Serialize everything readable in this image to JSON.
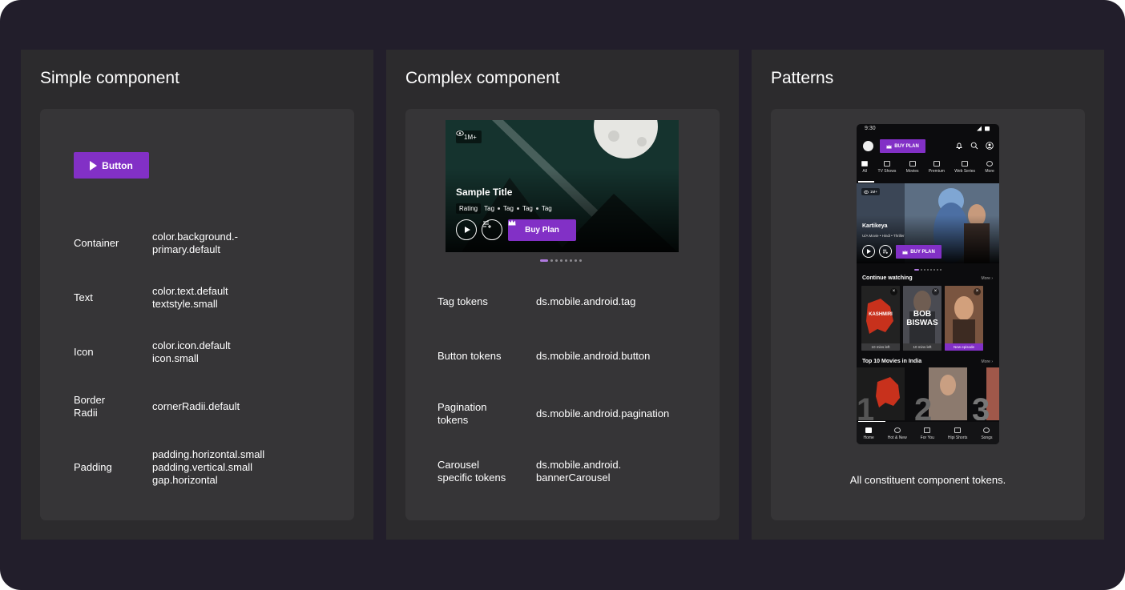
{
  "panels": {
    "simple": {
      "title": "Simple component",
      "button_label": "Button",
      "rows": [
        {
          "label": "Container",
          "value": "color.background.-\nprimary.default"
        },
        {
          "label": "Text",
          "value": "color.text.default\ntextstyle.small"
        },
        {
          "label": "Icon",
          "value": "color.icon.default\nicon.small"
        },
        {
          "label": "Border\nRadii",
          "value": "cornerRadii.default"
        },
        {
          "label": "Padding",
          "value": "padding.horizontal.small\npadding.vertical.small\ngap.horizontal"
        }
      ]
    },
    "complex": {
      "title": "Complex component",
      "banner": {
        "views": "1M+",
        "title": "Sample Title",
        "rating": "Rating",
        "tags": [
          "Tag",
          "Tag",
          "Tag",
          "Tag"
        ],
        "buy_label": "Buy Plan",
        "pager_count": 8,
        "pager_active": 0
      },
      "rows": [
        {
          "label": "Tag tokens",
          "value": "ds.mobile.android.tag"
        },
        {
          "label": "Button tokens",
          "value": "ds.mobile.android.button"
        },
        {
          "label": "Pagination\ntokens",
          "value": "ds.mobile.android.pagination"
        },
        {
          "label": "Carousel\nspecific tokens",
          "value": "ds.mobile.android.\nbannerCarousel"
        }
      ]
    },
    "patterns": {
      "title": "Patterns",
      "caption": "All constituent component tokens.",
      "phone": {
        "time": "9:30",
        "buy_label": "BUY PLAN",
        "nav": [
          "All",
          "TV Shows",
          "Movies",
          "Premium",
          "Web Series",
          "More"
        ],
        "hero_views": "1M+",
        "hero_title": "Kartikeya",
        "hero_meta": "U/A   Movie  •  Hindi  •  Thriller",
        "hero_buy": "BUY PLAN",
        "section1": "Continue watching",
        "section1_more": "More",
        "cards": [
          {
            "poster_text": "KASHMIRI",
            "caption": "10 mins left",
            "new": false
          },
          {
            "poster_text": "BOB\nBISWAS",
            "caption": "10 mins left",
            "new": false
          },
          {
            "poster_text": "",
            "caption": "New episode",
            "new": true
          }
        ],
        "section2": "Top 10 Movies in India",
        "section2_more": "More",
        "bottom_nav": [
          "Home",
          "Hot & New",
          "For You",
          "Hipi Shorts",
          "Songs"
        ]
      }
    }
  },
  "colors": {
    "frame_bg": "#221e2b",
    "panel_bg": "#2c2b2d",
    "inner_bg": "#363537",
    "accent": "#8230c6"
  }
}
